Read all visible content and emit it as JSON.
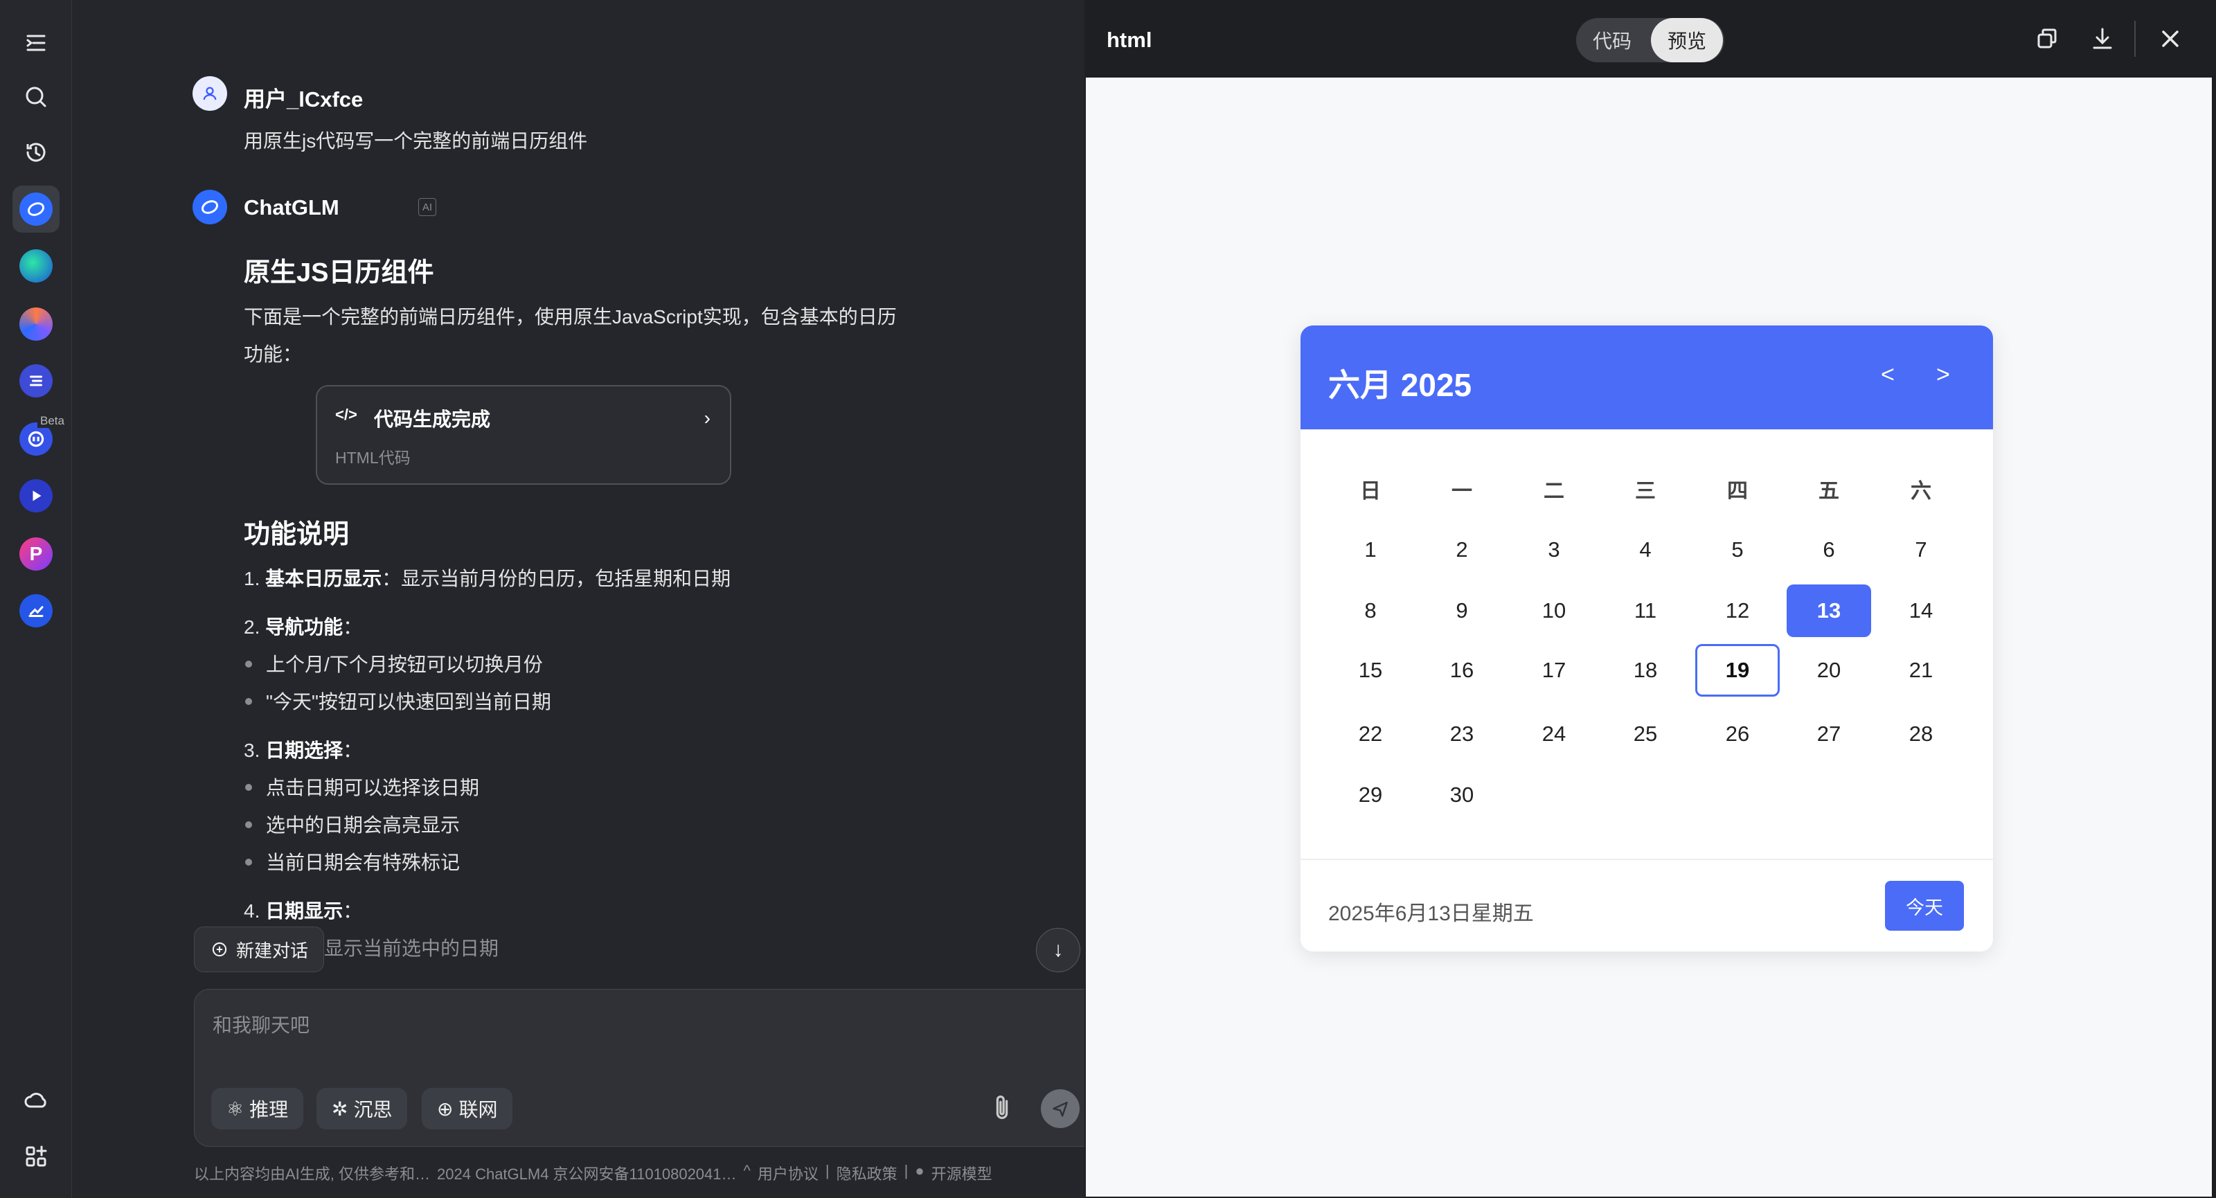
{
  "user": {
    "name": "用户_lCxfce",
    "message": "用原生js代码写一个完整的前端日历组件"
  },
  "assistant": {
    "name": "ChatGLM",
    "badge": "AI",
    "heading": "原生JS日历组件",
    "intro_line1": "下面是一个完整的前端日历组件，使用原生JavaScript实现，包含基本的日历",
    "intro_line2": "功能：",
    "code_card": {
      "title": "代码生成完成",
      "subtitle": "HTML代码",
      "icon": "code-icon"
    },
    "features_heading": "功能说明",
    "f1_num": "1.",
    "f1_bold": "基本日历显示",
    "f1_rest": "：显示当前月份的日历，包括星期和日期",
    "f2_num": "2.",
    "f2_bold": "导航功能",
    "f2_rest": "：",
    "f2_b1": "上个月/下个月按钮可以切换月份",
    "f2_b2": "\"今天\"按钮可以快速回到当前日期",
    "f3_num": "3.",
    "f3_bold": "日期选择",
    "f3_rest": "：",
    "f3_b1": "点击日期可以选择该日期",
    "f3_b2": "选中的日期会高亮显示",
    "f3_b3": "当前日期会有特殊标记",
    "f4_num": "4.",
    "f4_bold": "日期显示",
    "f4_rest": "：",
    "f4_b1": "底部会显示当前选中的日期"
  },
  "chat_controls": {
    "new_chat": "新建对话",
    "input_placeholder": "和我聊天吧",
    "pill_reason": "推理",
    "pill_think": "沉思",
    "pill_web": "联网"
  },
  "footer": {
    "disclaimer": "以上内容均由AI生成, 仅供参考和…",
    "icp": "2024 ChatGLM4 京公网安备11010802041…",
    "agreement": "用户协议",
    "privacy": "隐私政策",
    "open_model": "开源模型"
  },
  "rail": {
    "beta_label": "Beta"
  },
  "preview": {
    "title": "html",
    "tab_code": "代码",
    "tab_preview": "预览",
    "active_tab": "预览"
  },
  "calendar": {
    "title": "六月 2025",
    "prev": "<",
    "next": ">",
    "weekdays": [
      "日",
      "一",
      "二",
      "三",
      "四",
      "五",
      "六"
    ],
    "first_weekday_index": 0,
    "days": [
      "1",
      "2",
      "3",
      "4",
      "5",
      "6",
      "7",
      "8",
      "9",
      "10",
      "11",
      "12",
      "13",
      "14",
      "15",
      "16",
      "17",
      "18",
      "19",
      "20",
      "21",
      "22",
      "23",
      "24",
      "25",
      "26",
      "27",
      "28",
      "29",
      "30"
    ],
    "selected_day": "13",
    "today_marked_day": "19",
    "footer_text": "2025年6月13日星期五",
    "today_button": "今天",
    "accent_color": "#4a6cf7"
  }
}
